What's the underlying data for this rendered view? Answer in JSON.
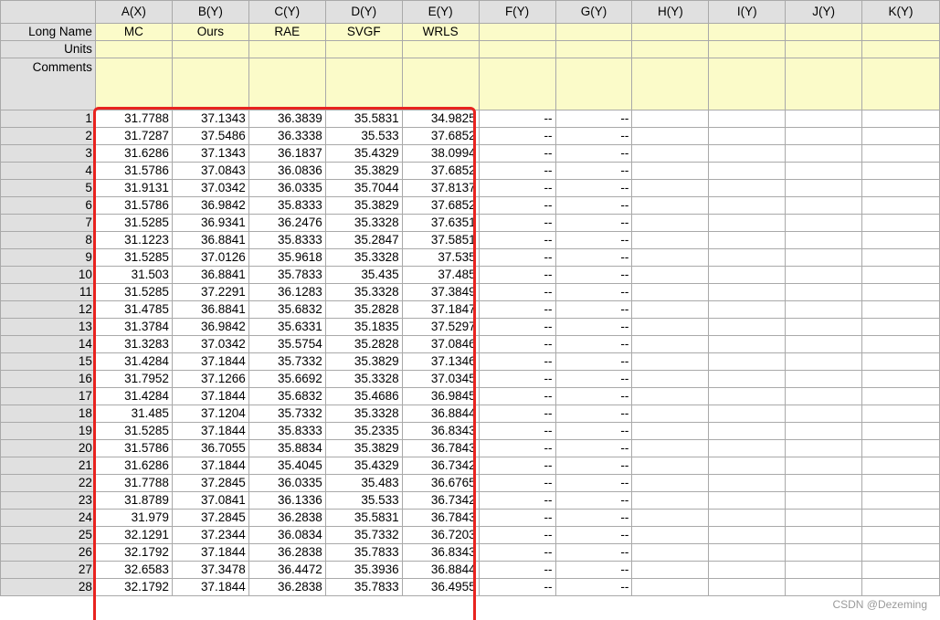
{
  "sheet": {
    "columns": [
      "A(X)",
      "B(Y)",
      "C(Y)",
      "D(Y)",
      "E(Y)",
      "F(Y)",
      "G(Y)",
      "H(Y)",
      "I(Y)",
      "J(Y)",
      "K(Y)"
    ],
    "meta_rows": [
      {
        "label": "Long Name",
        "values": [
          "MC",
          "Ours",
          "RAE",
          "SVGF",
          "WRLS",
          "",
          "",
          "",
          "",
          "",
          ""
        ]
      },
      {
        "label": "Units",
        "values": [
          "",
          "",
          "",
          "",
          "",
          "",
          "",
          "",
          "",
          "",
          ""
        ]
      },
      {
        "label": "Comments",
        "values": [
          "",
          "",
          "",
          "",
          "",
          "",
          "",
          "",
          "",
          "",
          ""
        ]
      }
    ],
    "rows": [
      {
        "n": "1",
        "v": [
          "31.7788",
          "37.1343",
          "36.3839",
          "35.5831",
          "34.9825",
          "--",
          "--"
        ]
      },
      {
        "n": "2",
        "v": [
          "31.7287",
          "37.5486",
          "36.3338",
          "35.533",
          "37.6852",
          "--",
          "--"
        ]
      },
      {
        "n": "3",
        "v": [
          "31.6286",
          "37.1343",
          "36.1837",
          "35.4329",
          "38.0994",
          "--",
          "--"
        ]
      },
      {
        "n": "4",
        "v": [
          "31.5786",
          "37.0843",
          "36.0836",
          "35.3829",
          "37.6852",
          "--",
          "--"
        ]
      },
      {
        "n": "5",
        "v": [
          "31.9131",
          "37.0342",
          "36.0335",
          "35.7044",
          "37.8137",
          "--",
          "--"
        ]
      },
      {
        "n": "6",
        "v": [
          "31.5786",
          "36.9842",
          "35.8333",
          "35.3829",
          "37.6852",
          "--",
          "--"
        ]
      },
      {
        "n": "7",
        "v": [
          "31.5285",
          "36.9341",
          "36.2476",
          "35.3328",
          "37.6351",
          "--",
          "--"
        ]
      },
      {
        "n": "8",
        "v": [
          "31.1223",
          "36.8841",
          "35.8333",
          "35.2847",
          "37.5851",
          "--",
          "--"
        ]
      },
      {
        "n": "9",
        "v": [
          "31.5285",
          "37.0126",
          "35.9618",
          "35.3328",
          "37.535",
          "--",
          "--"
        ]
      },
      {
        "n": "10",
        "v": [
          "31.503",
          "36.8841",
          "35.7833",
          "35.435",
          "37.485",
          "--",
          "--"
        ]
      },
      {
        "n": "11",
        "v": [
          "31.5285",
          "37.2291",
          "36.1283",
          "35.3328",
          "37.3849",
          "--",
          "--"
        ]
      },
      {
        "n": "12",
        "v": [
          "31.4785",
          "36.8841",
          "35.6832",
          "35.2828",
          "37.1847",
          "--",
          "--"
        ]
      },
      {
        "n": "13",
        "v": [
          "31.3784",
          "36.9842",
          "35.6331",
          "35.1835",
          "37.5297",
          "--",
          "--"
        ]
      },
      {
        "n": "14",
        "v": [
          "31.3283",
          "37.0342",
          "35.5754",
          "35.2828",
          "37.0846",
          "--",
          "--"
        ]
      },
      {
        "n": "15",
        "v": [
          "31.4284",
          "37.1844",
          "35.7332",
          "35.3829",
          "37.1346",
          "--",
          "--"
        ]
      },
      {
        "n": "16",
        "v": [
          "31.7952",
          "37.1266",
          "35.6692",
          "35.3328",
          "37.0345",
          "--",
          "--"
        ]
      },
      {
        "n": "17",
        "v": [
          "31.4284",
          "37.1844",
          "35.6832",
          "35.4686",
          "36.9845",
          "--",
          "--"
        ]
      },
      {
        "n": "18",
        "v": [
          "31.485",
          "37.1204",
          "35.7332",
          "35.3328",
          "36.8844",
          "--",
          "--"
        ]
      },
      {
        "n": "19",
        "v": [
          "31.5285",
          "37.1844",
          "35.8333",
          "35.2335",
          "36.8343",
          "--",
          "--"
        ]
      },
      {
        "n": "20",
        "v": [
          "31.5786",
          "36.7055",
          "35.8834",
          "35.3829",
          "36.7843",
          "--",
          "--"
        ]
      },
      {
        "n": "21",
        "v": [
          "31.6286",
          "37.1844",
          "35.4045",
          "35.4329",
          "36.7342",
          "--",
          "--"
        ]
      },
      {
        "n": "22",
        "v": [
          "31.7788",
          "37.2845",
          "36.0335",
          "35.483",
          "36.6765",
          "--",
          "--"
        ]
      },
      {
        "n": "23",
        "v": [
          "31.8789",
          "37.0841",
          "36.1336",
          "35.533",
          "36.7342",
          "--",
          "--"
        ]
      },
      {
        "n": "24",
        "v": [
          "31.979",
          "37.2845",
          "36.2838",
          "35.5831",
          "36.7843",
          "--",
          "--"
        ]
      },
      {
        "n": "25",
        "v": [
          "32.1291",
          "37.2344",
          "36.0834",
          "35.7332",
          "36.7203",
          "--",
          "--"
        ]
      },
      {
        "n": "26",
        "v": [
          "32.1792",
          "37.1844",
          "36.2838",
          "35.7833",
          "36.8343",
          "--",
          "--"
        ]
      },
      {
        "n": "27",
        "v": [
          "32.6583",
          "37.3478",
          "36.4472",
          "35.3936",
          "36.8844",
          "--",
          "--"
        ]
      },
      {
        "n": "28",
        "v": [
          "32.1792",
          "37.1844",
          "36.2838",
          "35.7833",
          "36.4955",
          "--",
          "--"
        ]
      }
    ]
  },
  "watermark": "CSDN @Dezeming",
  "colors": {
    "header_bg": "#e0e0e0",
    "meta_bg": "#fbfbc9",
    "highlight": "#e8231f",
    "grid": "#a9a9a9"
  }
}
